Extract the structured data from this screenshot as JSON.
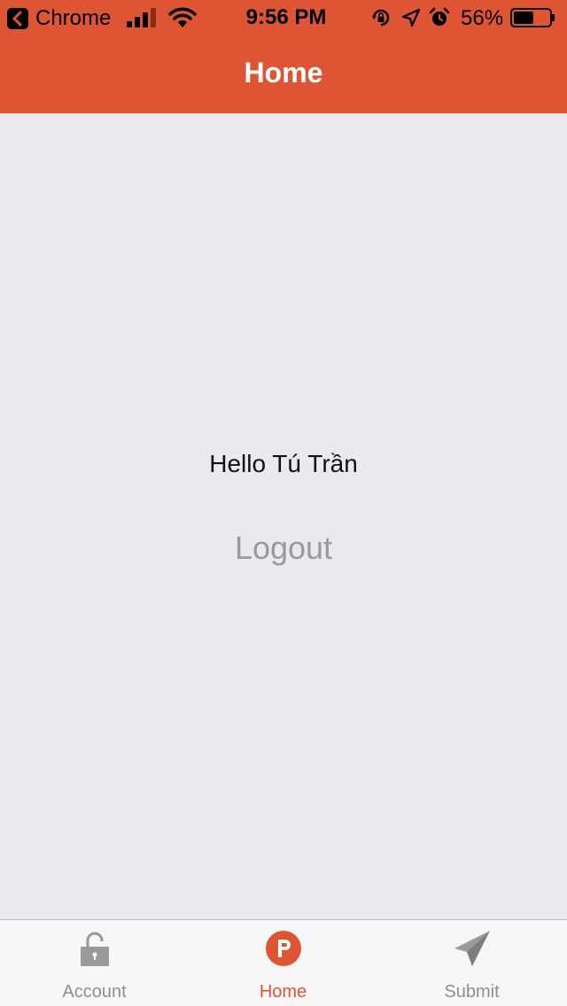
{
  "status_bar": {
    "app_name": "Chrome",
    "time": "9:56 PM",
    "battery_percent": "56%",
    "battery_level": 0.56
  },
  "header": {
    "title": "Home",
    "color": "#dd5533"
  },
  "main": {
    "greeting": "Hello Tú Trần",
    "logout_label": "Logout"
  },
  "tabbar": {
    "active_color": "#dd5533",
    "inactive_color": "#8e8e93",
    "tabs": [
      {
        "label": "Account",
        "icon": "lock-icon",
        "active": false
      },
      {
        "label": "Home",
        "icon": "product-hunt-icon",
        "active": true
      },
      {
        "label": "Submit",
        "icon": "paper-plane-icon",
        "active": false
      }
    ]
  }
}
